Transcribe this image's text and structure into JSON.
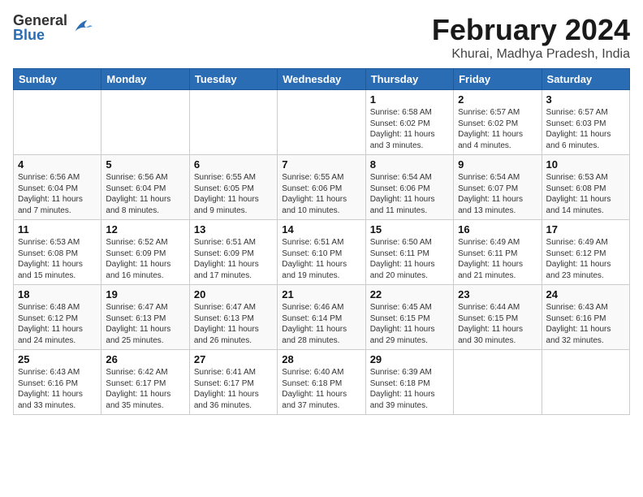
{
  "header": {
    "logo_general": "General",
    "logo_blue": "Blue",
    "month_title": "February 2024",
    "location": "Khurai, Madhya Pradesh, India"
  },
  "days_of_week": [
    "Sunday",
    "Monday",
    "Tuesday",
    "Wednesday",
    "Thursday",
    "Friday",
    "Saturday"
  ],
  "weeks": [
    [
      {
        "day": "",
        "info": ""
      },
      {
        "day": "",
        "info": ""
      },
      {
        "day": "",
        "info": ""
      },
      {
        "day": "",
        "info": ""
      },
      {
        "day": "1",
        "info": "Sunrise: 6:58 AM\nSunset: 6:02 PM\nDaylight: 11 hours\nand 3 minutes."
      },
      {
        "day": "2",
        "info": "Sunrise: 6:57 AM\nSunset: 6:02 PM\nDaylight: 11 hours\nand 4 minutes."
      },
      {
        "day": "3",
        "info": "Sunrise: 6:57 AM\nSunset: 6:03 PM\nDaylight: 11 hours\nand 6 minutes."
      }
    ],
    [
      {
        "day": "4",
        "info": "Sunrise: 6:56 AM\nSunset: 6:04 PM\nDaylight: 11 hours\nand 7 minutes."
      },
      {
        "day": "5",
        "info": "Sunrise: 6:56 AM\nSunset: 6:04 PM\nDaylight: 11 hours\nand 8 minutes."
      },
      {
        "day": "6",
        "info": "Sunrise: 6:55 AM\nSunset: 6:05 PM\nDaylight: 11 hours\nand 9 minutes."
      },
      {
        "day": "7",
        "info": "Sunrise: 6:55 AM\nSunset: 6:06 PM\nDaylight: 11 hours\nand 10 minutes."
      },
      {
        "day": "8",
        "info": "Sunrise: 6:54 AM\nSunset: 6:06 PM\nDaylight: 11 hours\nand 11 minutes."
      },
      {
        "day": "9",
        "info": "Sunrise: 6:54 AM\nSunset: 6:07 PM\nDaylight: 11 hours\nand 13 minutes."
      },
      {
        "day": "10",
        "info": "Sunrise: 6:53 AM\nSunset: 6:08 PM\nDaylight: 11 hours\nand 14 minutes."
      }
    ],
    [
      {
        "day": "11",
        "info": "Sunrise: 6:53 AM\nSunset: 6:08 PM\nDaylight: 11 hours\nand 15 minutes."
      },
      {
        "day": "12",
        "info": "Sunrise: 6:52 AM\nSunset: 6:09 PM\nDaylight: 11 hours\nand 16 minutes."
      },
      {
        "day": "13",
        "info": "Sunrise: 6:51 AM\nSunset: 6:09 PM\nDaylight: 11 hours\nand 17 minutes."
      },
      {
        "day": "14",
        "info": "Sunrise: 6:51 AM\nSunset: 6:10 PM\nDaylight: 11 hours\nand 19 minutes."
      },
      {
        "day": "15",
        "info": "Sunrise: 6:50 AM\nSunset: 6:11 PM\nDaylight: 11 hours\nand 20 minutes."
      },
      {
        "day": "16",
        "info": "Sunrise: 6:49 AM\nSunset: 6:11 PM\nDaylight: 11 hours\nand 21 minutes."
      },
      {
        "day": "17",
        "info": "Sunrise: 6:49 AM\nSunset: 6:12 PM\nDaylight: 11 hours\nand 23 minutes."
      }
    ],
    [
      {
        "day": "18",
        "info": "Sunrise: 6:48 AM\nSunset: 6:12 PM\nDaylight: 11 hours\nand 24 minutes."
      },
      {
        "day": "19",
        "info": "Sunrise: 6:47 AM\nSunset: 6:13 PM\nDaylight: 11 hours\nand 25 minutes."
      },
      {
        "day": "20",
        "info": "Sunrise: 6:47 AM\nSunset: 6:13 PM\nDaylight: 11 hours\nand 26 minutes."
      },
      {
        "day": "21",
        "info": "Sunrise: 6:46 AM\nSunset: 6:14 PM\nDaylight: 11 hours\nand 28 minutes."
      },
      {
        "day": "22",
        "info": "Sunrise: 6:45 AM\nSunset: 6:15 PM\nDaylight: 11 hours\nand 29 minutes."
      },
      {
        "day": "23",
        "info": "Sunrise: 6:44 AM\nSunset: 6:15 PM\nDaylight: 11 hours\nand 30 minutes."
      },
      {
        "day": "24",
        "info": "Sunrise: 6:43 AM\nSunset: 6:16 PM\nDaylight: 11 hours\nand 32 minutes."
      }
    ],
    [
      {
        "day": "25",
        "info": "Sunrise: 6:43 AM\nSunset: 6:16 PM\nDaylight: 11 hours\nand 33 minutes."
      },
      {
        "day": "26",
        "info": "Sunrise: 6:42 AM\nSunset: 6:17 PM\nDaylight: 11 hours\nand 35 minutes."
      },
      {
        "day": "27",
        "info": "Sunrise: 6:41 AM\nSunset: 6:17 PM\nDaylight: 11 hours\nand 36 minutes."
      },
      {
        "day": "28",
        "info": "Sunrise: 6:40 AM\nSunset: 6:18 PM\nDaylight: 11 hours\nand 37 minutes."
      },
      {
        "day": "29",
        "info": "Sunrise: 6:39 AM\nSunset: 6:18 PM\nDaylight: 11 hours\nand 39 minutes."
      },
      {
        "day": "",
        "info": ""
      },
      {
        "day": "",
        "info": ""
      }
    ]
  ]
}
